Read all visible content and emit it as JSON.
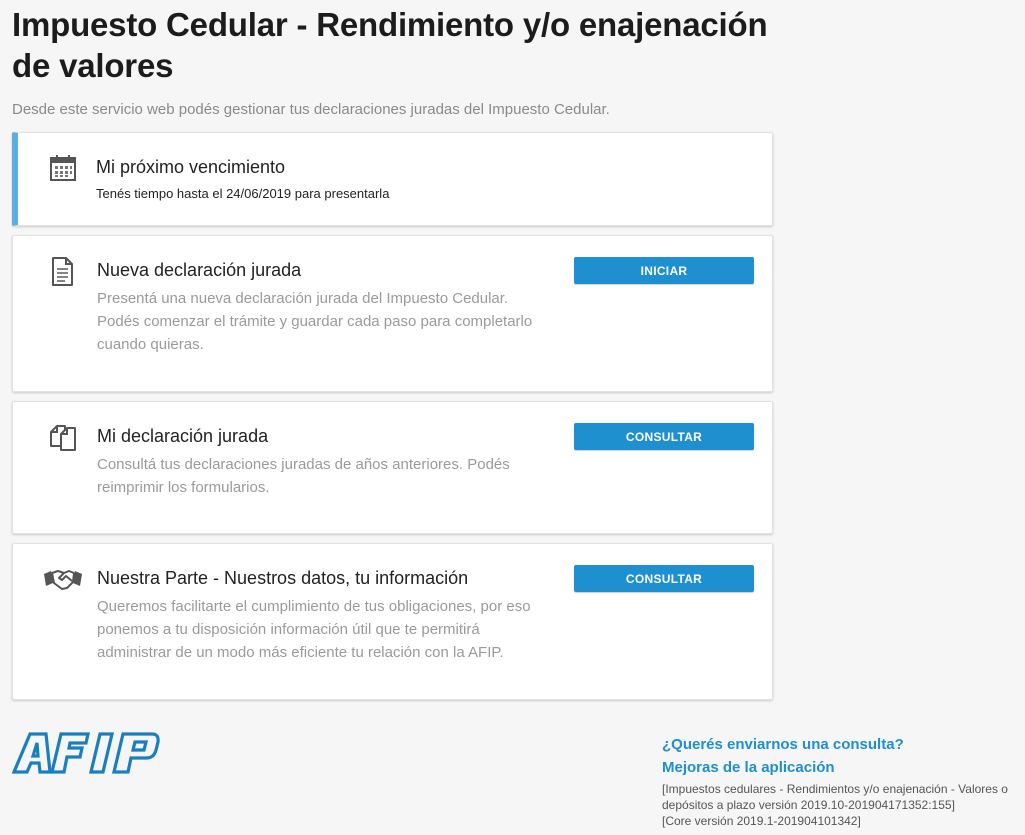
{
  "page": {
    "title": "Impuesto Cedular - Rendimiento y/o enajenación de valores",
    "subtitle": "Desde este servicio web podés gestionar tus declaraciones juradas del Impuesto Cedular."
  },
  "cards": [
    {
      "icon": "calendar-icon",
      "title": "Mi próximo vencimiento",
      "detail": "Tenés tiempo hasta el 24/06/2019 para presentarla"
    },
    {
      "icon": "document-icon",
      "title": "Nueva declaración jurada",
      "desc": "Presentá una nueva declaración jurada del Impuesto Cedular. Podés comenzar el trámite y guardar cada paso para completarlo cuando quieras.",
      "button": "INICIAR"
    },
    {
      "icon": "copy-documents-icon",
      "title": "Mi declaración jurada",
      "desc": "Consultá tus declaraciones juradas de años anteriores. Podés reimprimir los formularios.",
      "button": "CONSULTAR"
    },
    {
      "icon": "handshake-icon",
      "title": "Nuestra Parte - Nuestros datos, tu información",
      "desc": "Queremos facilitarte el cumplimiento de tus obligaciones, por eso ponemos a tu disposición información útil que te permitirá administrar de un modo más eficiente tu relación con la AFIP.",
      "button": "CONSULTAR"
    }
  ],
  "footer": {
    "logo": "AFIP",
    "link_consulta": "¿Querés enviarnos una consulta?",
    "link_mejoras": "Mejoras de la aplicación",
    "version_app": "[Impuestos cedulares - Rendimientos y/o enajenación - Valores o depósitos a plazo versión 2019.10-201904171352:155]",
    "version_core": "[Core versión 2019.1-201904101342]"
  },
  "colors": {
    "accent": "#5aaee0",
    "button": "#1e8fcf",
    "logo": "#1a7fc1"
  }
}
